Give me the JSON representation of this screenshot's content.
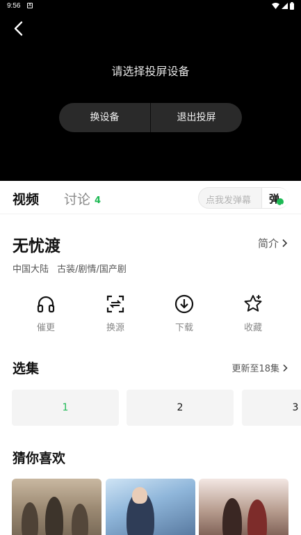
{
  "status_bar": {
    "time": "9:56",
    "notification_icon": "A"
  },
  "player": {
    "cast_message": "请选择投屏设备",
    "switch_device_label": "换设备",
    "exit_cast_label": "退出投屏"
  },
  "tabs": {
    "video_label": "视频",
    "discuss_label": "讨论",
    "discuss_count": "4",
    "danmu_placeholder": "点我发弹幕",
    "danmu_toggle_label": "弹"
  },
  "show": {
    "title": "无忧渡",
    "intro_label": "简介",
    "region": "中国大陆",
    "genres": "古装/剧情/国产剧"
  },
  "actions": [
    {
      "label": "催更",
      "icon": "headphones-icon"
    },
    {
      "label": "换源",
      "icon": "switch-source-icon"
    },
    {
      "label": "下载",
      "icon": "download-icon"
    },
    {
      "label": "收藏",
      "icon": "star-icon"
    }
  ],
  "episodes": {
    "title": "选集",
    "update_text": "更新至18集",
    "items": [
      "1",
      "2",
      "3"
    ],
    "active_index": 0
  },
  "recommendations": {
    "title": "猜你喜欢"
  },
  "colors": {
    "accent": "#1db954",
    "player_background": "#000000",
    "pill_background": "#2a2a2a"
  }
}
